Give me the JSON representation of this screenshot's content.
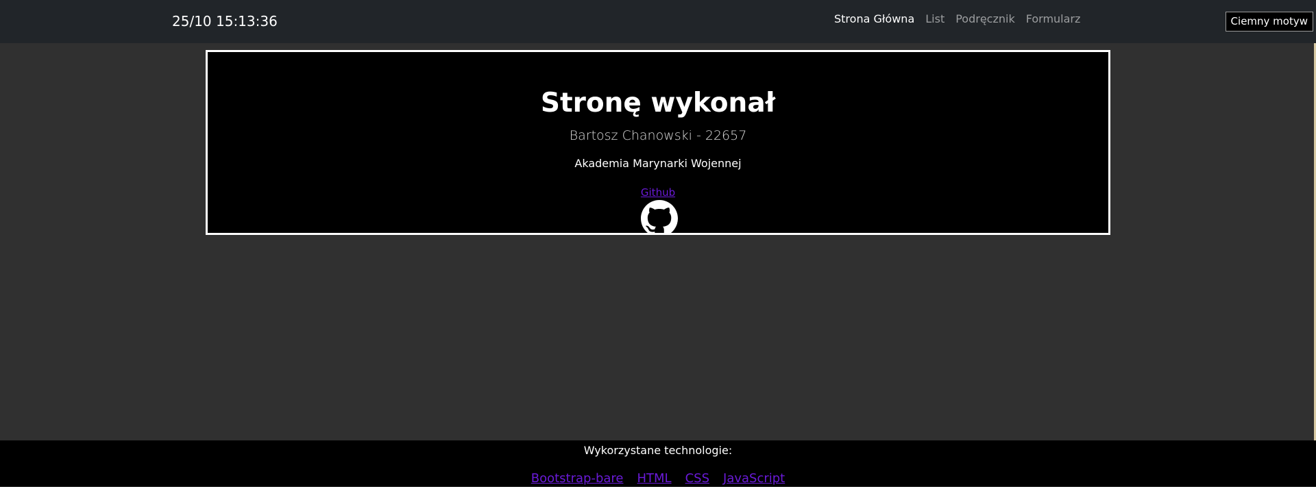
{
  "header": {
    "clock": "25/10 15:13:36",
    "nav": [
      {
        "label": "Strona Główna",
        "active": true
      },
      {
        "label": "List",
        "active": false
      },
      {
        "label": "Podręcznik",
        "active": false
      },
      {
        "label": "Formularz",
        "active": false
      }
    ],
    "theme_button": "Ciemny motyw"
  },
  "card": {
    "title": "Stronę wykonał",
    "author": "Bartosz Chanowski - 22657",
    "school": "Akademia Marynarki Wojennej",
    "link_label": "Github",
    "logo_icon": "github-icon"
  },
  "footer": {
    "title": "Wykorzystane technologie:",
    "links": [
      "Bootstrap-bare",
      "HTML",
      "CSS",
      "JavaScript"
    ]
  },
  "colors": {
    "page_background": "#303030",
    "navbar_background": "#212529",
    "card_background": "#000000",
    "link": "#6a1ad8"
  }
}
